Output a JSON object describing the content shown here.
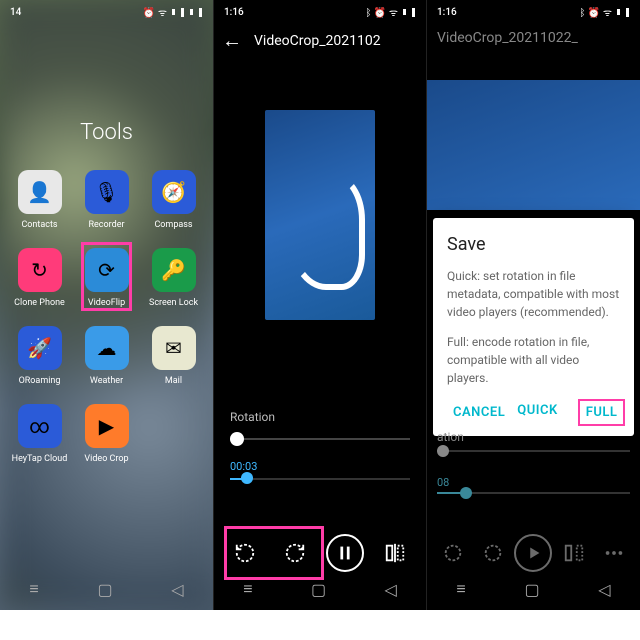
{
  "panel1": {
    "status_time": "14",
    "title": "Tools",
    "apps": [
      {
        "label": "Contacts",
        "bg": "#e8e8e8",
        "glyph": "👤"
      },
      {
        "label": "Recorder",
        "bg": "#2b5bd8",
        "glyph": "🎙"
      },
      {
        "label": "Compass",
        "bg": "#2b5bd8",
        "glyph": "🧭"
      },
      {
        "label": "Clone Phone",
        "bg": "#ff3b7a",
        "glyph": "↻"
      },
      {
        "label": "VideoFlip",
        "bg": "#2b8bd8",
        "glyph": "⟳",
        "highlight": true
      },
      {
        "label": "Screen Lock",
        "bg": "#1a9b4a",
        "glyph": "🔑"
      },
      {
        "label": "ORoaming",
        "bg": "#2b5bd8",
        "glyph": "🚀"
      },
      {
        "label": "Weather",
        "bg": "#3a9be8",
        "glyph": "☁"
      },
      {
        "label": "Mail",
        "bg": "#e8e8d0",
        "glyph": "✉"
      },
      {
        "label": "HeyTap Cloud",
        "bg": "#2b5bd8",
        "glyph": "∞"
      },
      {
        "label": "Video Crop",
        "bg": "#ff7b2a",
        "glyph": "▶"
      }
    ]
  },
  "panel2": {
    "status_time": "1:16",
    "title": "VideoCrop_2021102",
    "rotation_label": "Rotation",
    "time": "00:03",
    "controls": [
      "rotate-ccw",
      "rotate-cw",
      "pause",
      "flip"
    ]
  },
  "panel3": {
    "status_time": "1:16",
    "title": "VideoCrop_20211022_",
    "bottom_label": "ation",
    "bottom_time": "08",
    "dialog": {
      "title": "Save",
      "quick_text": "Quick: set rotation in file metadata, compatible with most video players (recommended).",
      "full_text": "Full: encode rotation in file, compatible with all video players.",
      "cancel": "CANCEL",
      "quick": "QUICK",
      "full": "FULL"
    }
  }
}
